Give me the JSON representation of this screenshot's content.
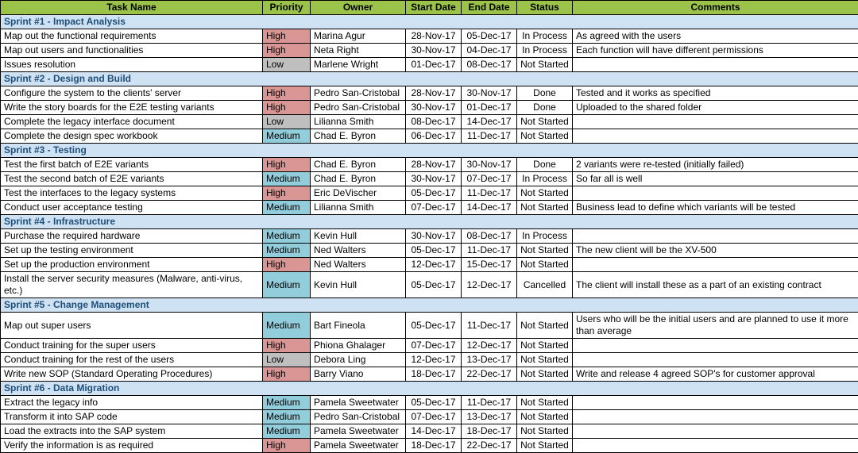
{
  "headers": {
    "task": "Task Name",
    "priority": "Priority",
    "owner": "Owner",
    "start": "Start Date",
    "end": "End Date",
    "status": "Status",
    "comments": "Comments"
  },
  "sprints": [
    {
      "title": "Sprint #1 - Impact Analysis",
      "rows": [
        {
          "task": "Map out the functional requirements",
          "priority": "High",
          "owner": "Marina Agur",
          "start": "28-Nov-17",
          "end": "05-Dec-17",
          "status": "In Process",
          "comments": "As agreed with the users"
        },
        {
          "task": "Map out users and functionalities",
          "priority": "High",
          "owner": "Neta Right",
          "start": "30-Nov-17",
          "end": "04-Dec-17",
          "status": "In Process",
          "comments": "Each function will have different permissions"
        },
        {
          "task": "Issues resolution",
          "priority": "Low",
          "owner": "Marlene Wright",
          "start": "01-Dec-17",
          "end": "08-Dec-17",
          "status": "Not Started",
          "comments": ""
        }
      ]
    },
    {
      "title": "Sprint #2 - Design and Build",
      "rows": [
        {
          "task": "Configure the system to the clients' server",
          "priority": "High",
          "owner": "Pedro San-Cristobal",
          "start": "28-Nov-17",
          "end": "30-Nov-17",
          "status": "Done",
          "comments": "Tested and it works as specified"
        },
        {
          "task": "Write the story boards for the E2E testing variants",
          "priority": "High",
          "owner": "Pedro San-Cristobal",
          "start": "30-Nov-17",
          "end": "01-Dec-17",
          "status": "Done",
          "comments": "Uploaded to the shared folder"
        },
        {
          "task": "Complete the legacy interface document",
          "priority": "Low",
          "owner": "Lilianna Smith",
          "start": "08-Dec-17",
          "end": "14-Dec-17",
          "status": "Not Started",
          "comments": ""
        },
        {
          "task": "Complete the design spec workbook",
          "priority": "Medium",
          "owner": "Chad E. Byron",
          "start": "06-Dec-17",
          "end": "11-Dec-17",
          "status": "Not Started",
          "comments": ""
        }
      ]
    },
    {
      "title": "Sprint #3 - Testing",
      "rows": [
        {
          "task": "Test the first batch of E2E variants",
          "priority": "High",
          "owner": "Chad E. Byron",
          "start": "28-Nov-17",
          "end": "30-Nov-17",
          "status": "Done",
          "comments": "2 variants were re-tested (initially failed)"
        },
        {
          "task": "Test the second batch of E2E variants",
          "priority": "Medium",
          "owner": "Chad E. Byron",
          "start": "30-Nov-17",
          "end": "07-Dec-17",
          "status": "In Process",
          "comments": "So far all is well"
        },
        {
          "task": "Test the interfaces to the legacy systems",
          "priority": "High",
          "owner": "Eric DeVischer",
          "start": "05-Dec-17",
          "end": "11-Dec-17",
          "status": "Not Started",
          "comments": ""
        },
        {
          "task": "Conduct user acceptance testing",
          "priority": "Medium",
          "owner": "Lilianna Smith",
          "start": "07-Dec-17",
          "end": "14-Dec-17",
          "status": "Not Started",
          "comments": "Business lead to define which variants will be tested"
        }
      ]
    },
    {
      "title": "Sprint #4 - Infrastructure",
      "rows": [
        {
          "task": "Purchase the required hardware",
          "priority": "Medium",
          "owner": "Kevin Hull",
          "start": "30-Nov-17",
          "end": "08-Dec-17",
          "status": "In Process",
          "comments": ""
        },
        {
          "task": "Set up the testing environment",
          "priority": "Medium",
          "owner": "Ned Walters",
          "start": "05-Dec-17",
          "end": "11-Dec-17",
          "status": "Not Started",
          "comments": "The new client will be the XV-500"
        },
        {
          "task": "Set up the production environment",
          "priority": "High",
          "owner": "Ned Walters",
          "start": "12-Dec-17",
          "end": "15-Dec-17",
          "status": "Not Started",
          "comments": ""
        },
        {
          "task": "Install the server security measures (Malware, anti-virus, etc.)",
          "priority": "Medium",
          "owner": "Kevin Hull",
          "start": "05-Dec-17",
          "end": "12-Dec-17",
          "status": "Cancelled",
          "comments": "The client will install these as a part of an existing contract"
        }
      ]
    },
    {
      "title": "Sprint #5 - Change Management",
      "rows": [
        {
          "task": "Map out super users",
          "priority": "Medium",
          "owner": "Bart Fineola",
          "start": "05-Dec-17",
          "end": "11-Dec-17",
          "status": "Not Started",
          "comments": "Users who will be the initial users and are planned to use it more than average"
        },
        {
          "task": "Conduct training for the super users",
          "priority": "High",
          "owner": "Phiona Ghalager",
          "start": "07-Dec-17",
          "end": "12-Dec-17",
          "status": "Not Started",
          "comments": ""
        },
        {
          "task": "Conduct training for the rest of the users",
          "priority": "Low",
          "owner": "Debora Ling",
          "start": "12-Dec-17",
          "end": "13-Dec-17",
          "status": "Not Started",
          "comments": ""
        },
        {
          "task": "Write new SOP (Standard Operating Procedures)",
          "priority": "High",
          "owner": "Barry Viano",
          "start": "18-Dec-17",
          "end": "22-Dec-17",
          "status": "Not Started",
          "comments": "Write and release 4 agreed SOP's for customer approval"
        }
      ]
    },
    {
      "title": "Sprint #6 - Data Migration",
      "rows": [
        {
          "task": "Extract the legacy info",
          "priority": "Medium",
          "owner": "Pamela Sweetwater",
          "start": "05-Dec-17",
          "end": "11-Dec-17",
          "status": "Not Started",
          "comments": ""
        },
        {
          "task": "Transform it into SAP code",
          "priority": "Medium",
          "owner": "Pedro San-Cristobal",
          "start": "07-Dec-17",
          "end": "13-Dec-17",
          "status": "Not Started",
          "comments": ""
        },
        {
          "task": "Load the extracts into the SAP system",
          "priority": "Medium",
          "owner": "Pamela Sweetwater",
          "start": "14-Dec-17",
          "end": "18-Dec-17",
          "status": "Not Started",
          "comments": ""
        },
        {
          "task": "Verify the information is as required",
          "priority": "High",
          "owner": "Pamela Sweetwater",
          "start": "18-Dec-17",
          "end": "22-Dec-17",
          "status": "Not Started",
          "comments": ""
        }
      ]
    }
  ]
}
